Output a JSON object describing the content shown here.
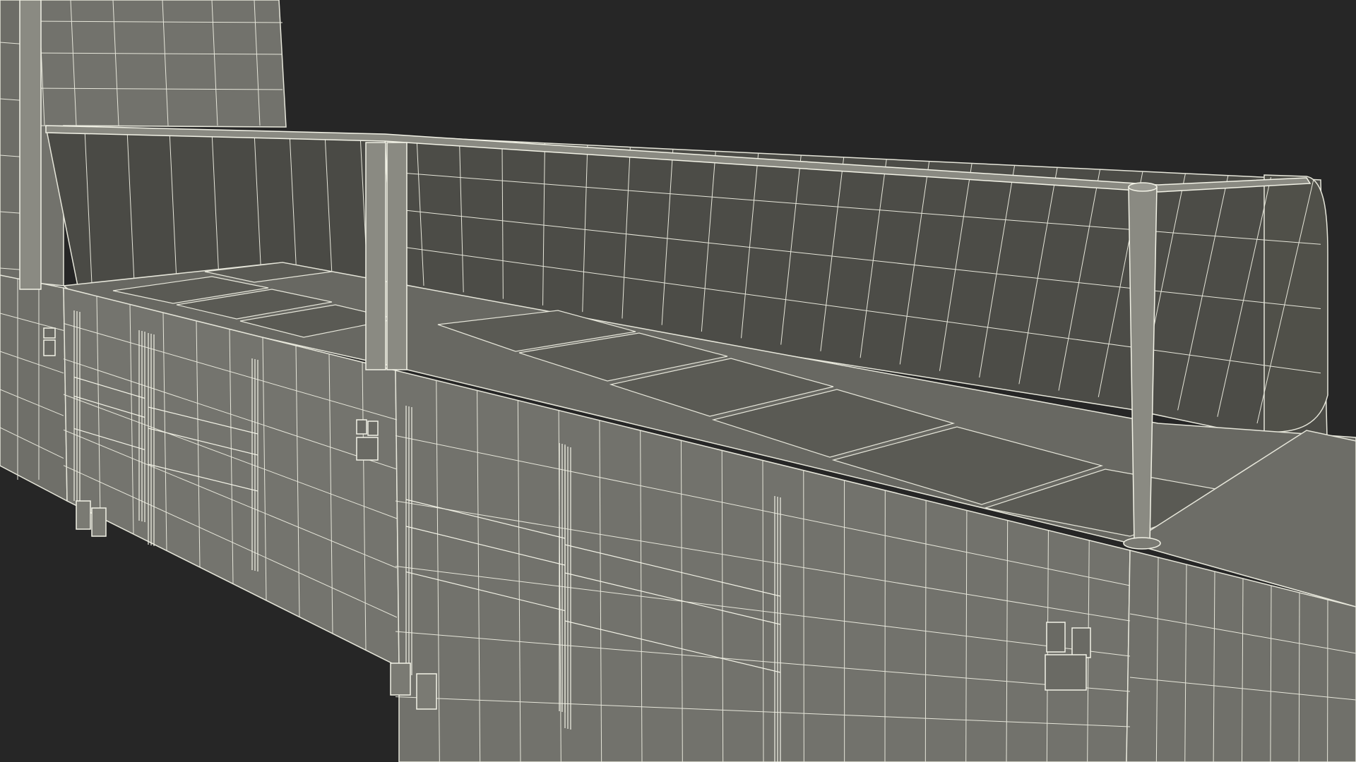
{
  "scene": {
    "subject": "buffet-serving-counter-wireframe",
    "render_style": "wireframe",
    "colors": {
      "background": "#262626",
      "surface": "#70706a",
      "surface_dark": "#4a4a45",
      "surface_mid": "#5f5f59",
      "wire": "#e6e6da",
      "wire_dense": "#f2f2e6"
    }
  }
}
